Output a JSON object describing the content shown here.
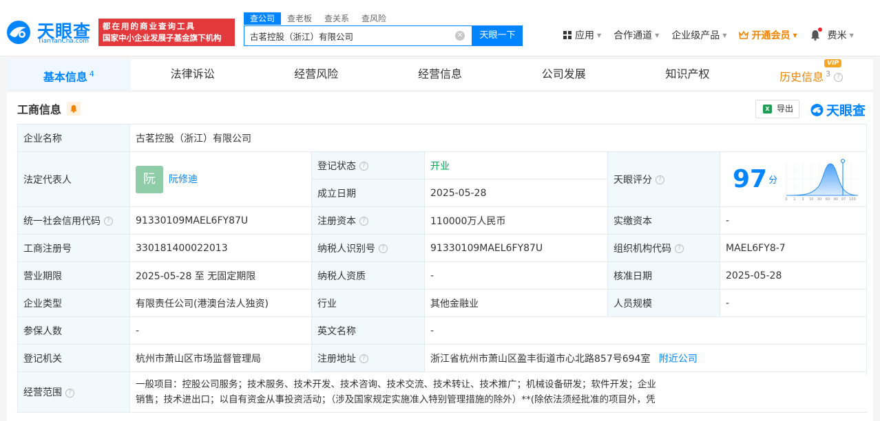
{
  "header": {
    "logo_text": "天眼查",
    "logo_sub": "TianYanCha.com",
    "promo_line1": "都在用的商业查询工具",
    "promo_line2": "国家中小企业发展子基金旗下机构",
    "search_tabs": [
      "查公司",
      "查老板",
      "查关系",
      "查风险"
    ],
    "search_value": "古茗控股（浙江）有限公司",
    "search_button": "天眼一下",
    "nav": {
      "app": "应用",
      "channel": "合作通道",
      "enterprise": "企业级产品",
      "vip": "开通会员",
      "user": "费米"
    }
  },
  "tabs": [
    {
      "label": "基本信息",
      "count": "4"
    },
    {
      "label": "法律诉讼",
      "count": ""
    },
    {
      "label": "经营风险",
      "count": ""
    },
    {
      "label": "经营信息",
      "count": ""
    },
    {
      "label": "公司发展",
      "count": ""
    },
    {
      "label": "知识产权",
      "count": ""
    },
    {
      "label": "历史信息",
      "count": "3"
    }
  ],
  "vip_badge": "VIP",
  "section": {
    "title": "工商信息",
    "export_label": "导出",
    "watermark": "天眼查"
  },
  "info": {
    "company_name_label": "企业名称",
    "company_name": "古茗控股（浙江）有限公司",
    "legal_rep_label": "法定代表人",
    "legal_rep_avatar": "阮",
    "legal_rep": "阮修迪",
    "reg_status_label": "登记状态",
    "reg_status": "开业",
    "established_label": "成立日期",
    "established": "2025-05-28",
    "score_label": "天眼评分",
    "score": "97",
    "score_unit": "分",
    "score_ticks": [
      "0",
      "1",
      "3",
      "10",
      "30",
      "60",
      "80",
      "97",
      "100"
    ],
    "credit_code_label": "统一社会信用代码",
    "credit_code": "91330109MAEL6FY87U",
    "reg_capital_label": "注册资本",
    "reg_capital": "110000万人民币",
    "paid_capital_label": "实缴资本",
    "paid_capital": "-",
    "reg_no_label": "工商注册号",
    "reg_no": "330181400022013",
    "taxpayer_id_label": "纳税人识别号",
    "taxpayer_id": "91330109MAEL6FY87U",
    "org_code_label": "组织机构代码",
    "org_code": "MAEL6FY8-7",
    "term_label": "营业期限",
    "term": "2025-05-28 至 无固定期限",
    "taxpayer_qual_label": "纳税人资质",
    "taxpayer_qual": "-",
    "approval_date_label": "核准日期",
    "approval_date": "2025-05-28",
    "type_label": "企业类型",
    "type": "有限责任公司(港澳台法人独资)",
    "industry_label": "行业",
    "industry": "其他金融业",
    "staff_label": "人员规模",
    "staff": "-",
    "insured_label": "参保人数",
    "insured": "-",
    "english_name_label": "英文名称",
    "english_name": "-",
    "authority_label": "登记机关",
    "authority": "杭州市萧山区市场监督管理局",
    "address_label": "注册地址",
    "address": "浙江省杭州市萧山区盈丰街道市心北路857号694室",
    "nearby_link": "附近公司",
    "scope_label": "经营范围",
    "scope_line1": "一般项目：控股公司服务；技术服务、技术开发、技术咨询、技术交流、技术转让、技术推广；机械设备研发；软件开发；企业",
    "scope_line2": "销售；技术进出口；以自有资金从事投资活动；（涉及国家规定实施准入特别管理措施的除外）**(除依法须经批准的项目外，凭"
  },
  "colors": {
    "brand": "#0084ff",
    "promo": "#e4393c",
    "vip": "#f08300",
    "status_green": "#00a854"
  }
}
